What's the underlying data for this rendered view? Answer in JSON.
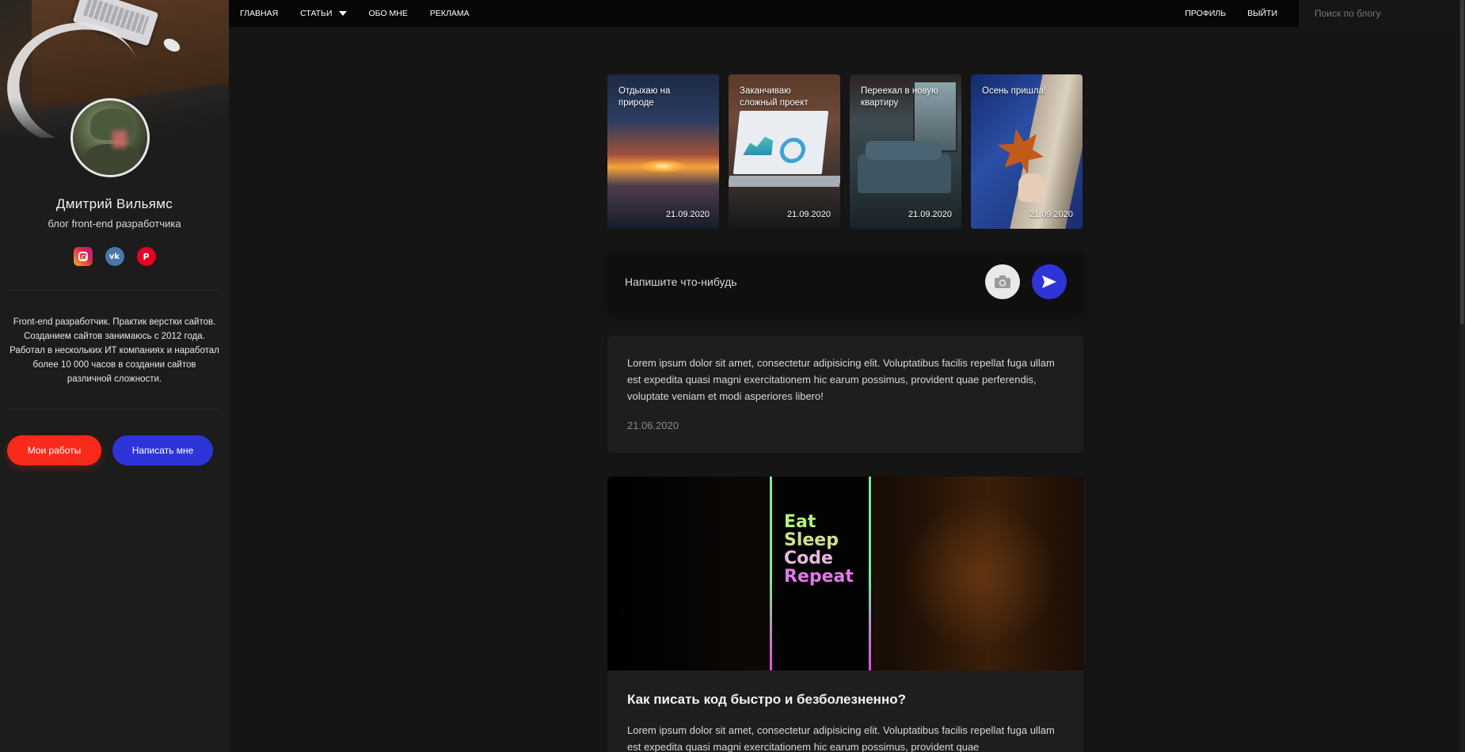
{
  "nav": {
    "left": [
      {
        "label": "ГЛАВНАЯ"
      },
      {
        "label": "СТАТЬИ"
      },
      {
        "label": "ОБО МНЕ"
      },
      {
        "label": "РЕКЛАМА"
      }
    ],
    "profile": "ПРОФИЛЬ",
    "logout": "ВЫЙТИ",
    "search_placeholder": "Поиск по блогу"
  },
  "sidebar": {
    "name": "Дмитрий Вильямс",
    "subtitle": "блог front-end разработчика",
    "socials": [
      "instagram-icon",
      "vk-icon",
      "pinterest-icon"
    ],
    "vk_glyph": "vk",
    "pin_glyph": "P",
    "bio": "Front-end разработчик. Практик верстки сайтов. Созданием сайтов занимаюсь с 2012 года. Работал в нескольких ИТ компаниях и наработал более 10 000 часов в создании сайтов различной сложности.",
    "btn_works": "Мои работы",
    "btn_write": "Написать мне"
  },
  "stories": [
    {
      "title": "Отдыхаю на природе",
      "date": "21.09.2020"
    },
    {
      "title": "Заканчиваю сложный проект",
      "date": "21.09.2020"
    },
    {
      "title": "Переехал в новую квартиру",
      "date": "21.09.2020"
    },
    {
      "title": "Осень пришла!",
      "date": "21.09.2020"
    }
  ],
  "composer": {
    "placeholder": "Напишите что-нибудь",
    "camera_icon": "camera-icon",
    "send_icon": "send-icon"
  },
  "posts": [
    {
      "text": "Lorem ipsum dolor sit amet, consectetur adipisicing elit. Voluptatibus facilis repellat fuga ullam est expedita quasi magni exercitationem hic earum possimus, provident quae perferendis, voluptate veniam et modi asperiores libero!",
      "date": "21.06.2020"
    },
    {
      "image_text": [
        "Eat",
        "Sleep",
        "Code",
        "Repeat"
      ],
      "title": "Как писать код быстро и безболезненно?",
      "text": "Lorem ipsum dolor sit amet, consectetur adipisicing elit. Voluptatibus facilis repellat fuga ullam est expedita quasi magni exercitationem hic earum possimus, provident quae"
    }
  ],
  "colors": {
    "accent_red": "#fa2a1a",
    "accent_blue": "#2e35d8",
    "bg": "#151515",
    "sidebar_bg": "#1c1c1c",
    "card_bg": "#1e1e1e"
  }
}
